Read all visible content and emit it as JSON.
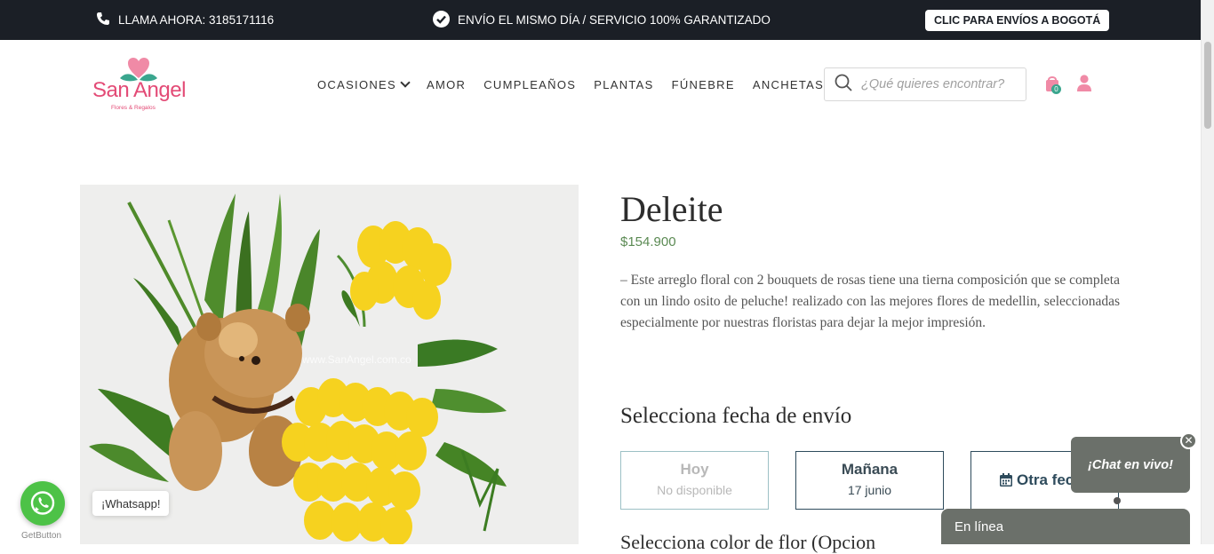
{
  "topbar": {
    "phone_text": "LLAMA AHORA: 3185171116",
    "shipping_text": "ENVÍO EL MISMO DÍA / SERVICIO 100% GARANTIZADO",
    "cta_button": "CLIC PARA ENVÍOS A BOGOTÁ"
  },
  "logo": {
    "name": "San Angel",
    "tagline": "Flores & Regalos"
  },
  "nav": {
    "items": [
      "OCASIONES",
      "AMOR",
      "CUMPLEAÑOS",
      "PLANTAS",
      "FÚNEBRE",
      "ANCHETAS"
    ]
  },
  "search": {
    "placeholder": "¿Qué quieres encontrar?"
  },
  "cart": {
    "count": "0"
  },
  "product": {
    "title": "Deleite",
    "price": "$154.900",
    "description": "– Este arreglo floral con 2 bouquets de rosas tiene una tierna composición que se completa con un lindo osito de peluche! realizado con las mejores flores de medellin, seleccionadas especialmente por nuestras floristas para dejar la mejor impresión.",
    "watermark": "www.SanAngel.com.co"
  },
  "delivery": {
    "title": "Selecciona fecha de envío",
    "options": [
      {
        "title": "Hoy",
        "sub": "No disponible"
      },
      {
        "title": "Mañana",
        "sub": "17 junio"
      },
      {
        "title": "Otra fec"
      }
    ],
    "next_section_title": "Selecciona color de flor (Opcion"
  },
  "whatsapp": {
    "label": "¡Whatsapp!",
    "provider": "GetButton"
  },
  "chat": {
    "bubble": "¡Chat en vivo!",
    "status": "En línea"
  },
  "colors": {
    "topbar": "#1b1f26",
    "brand_pink": "#e34b76",
    "price_green": "#5b8a53",
    "whatsapp_green": "#4dc247",
    "chat_gray": "#6b706a"
  }
}
